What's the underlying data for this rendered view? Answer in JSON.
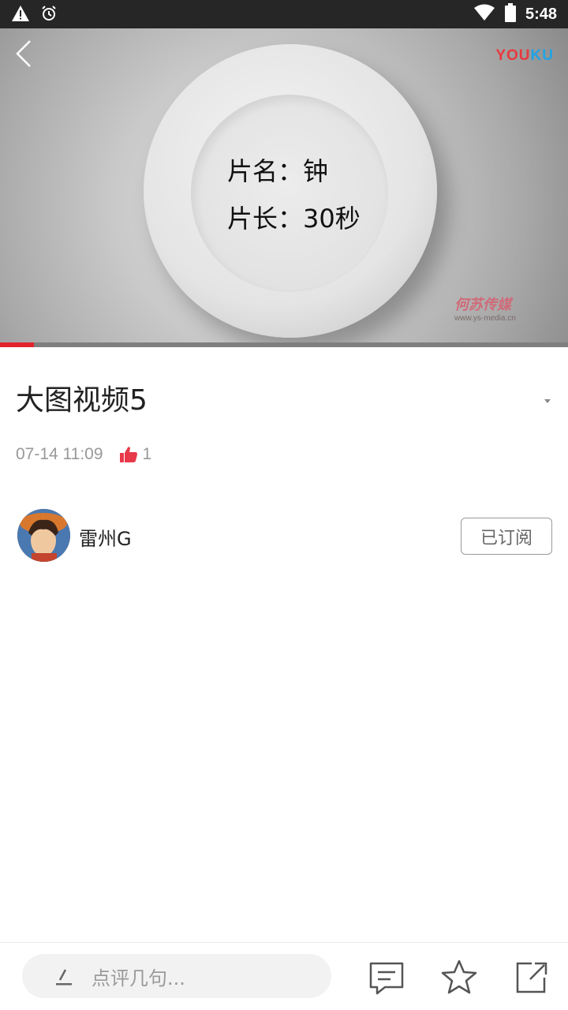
{
  "status_bar": {
    "time": "5:48",
    "left_icons": [
      "warning-icon",
      "alarm-icon"
    ],
    "right_icons": [
      "wifi-icon",
      "battery-icon"
    ]
  },
  "video": {
    "overlay_line1": "片名：钟",
    "overlay_line2": "片长：30秒",
    "logo_you": "YOU",
    "logo_ku": "KU",
    "watermark_brand": "何苏传媒",
    "watermark_url": "www.ys-media.cn",
    "progress_fraction": 0.06,
    "accent_color": "#e2232a"
  },
  "article": {
    "title": "大图视频5",
    "date": "07-14 11:09",
    "like_count": "1"
  },
  "author": {
    "name": "雷州G",
    "subscribe_label": "已订阅"
  },
  "bottom_bar": {
    "comment_placeholder": "点评几句...",
    "icons": [
      "edit-icon",
      "comment-icon",
      "star-icon",
      "share-icon"
    ]
  }
}
